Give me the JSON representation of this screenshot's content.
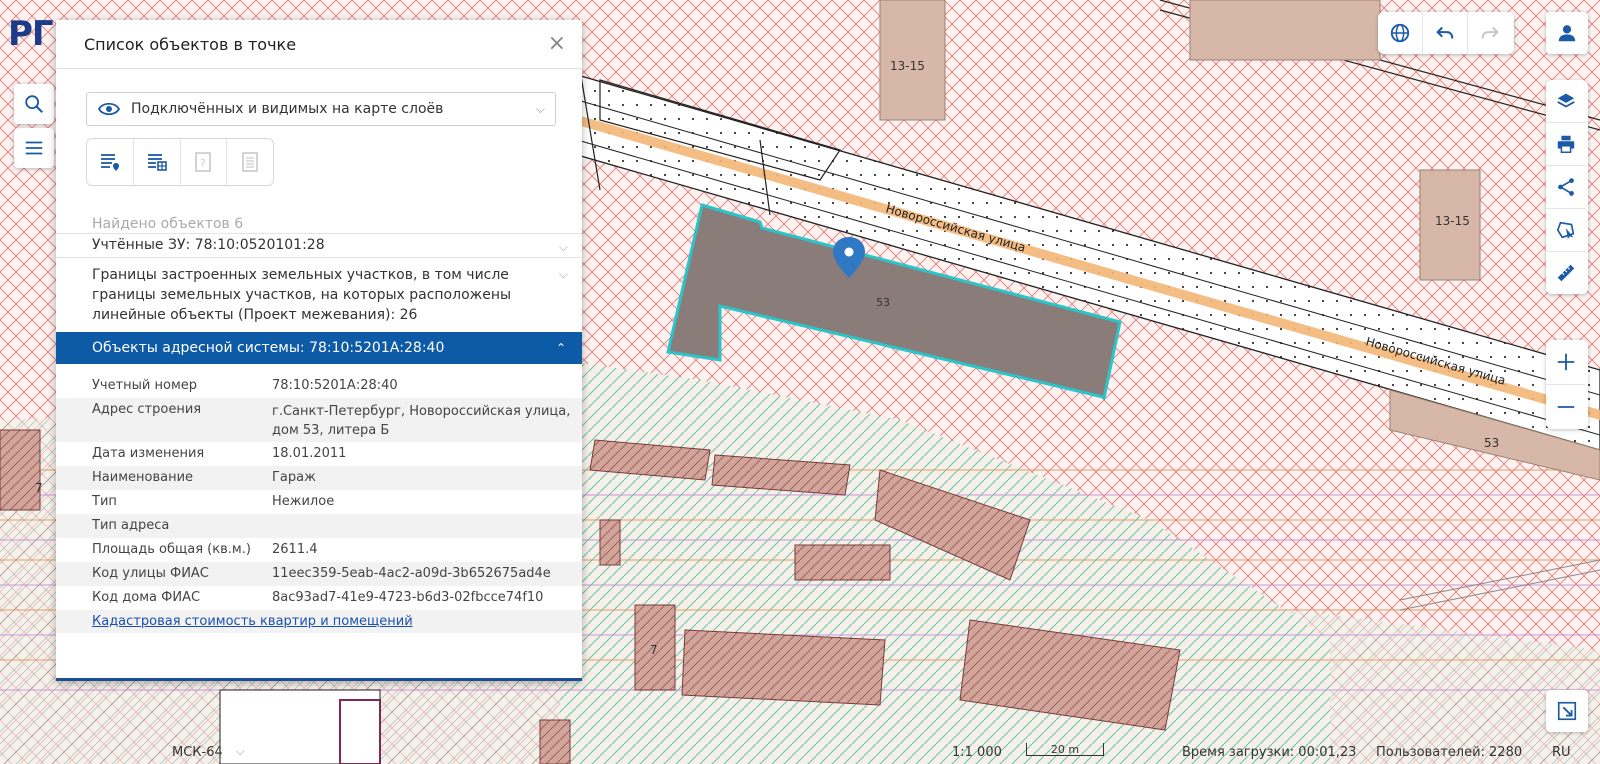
{
  "brand": {
    "logo_text": "РГ"
  },
  "panel": {
    "title": "Список объектов в точке",
    "close_glyph": "×",
    "layer_select_value": "Подключённых и видимых на карте слоёв",
    "found_text": "Найдено объектов 6",
    "accordion": [
      {
        "label": "Учтённые ЗУ: 78:10:0520101:28"
      },
      {
        "label": "Границы застроенных земельных участков, в том числе границы земельных участков, на которых расположены линейные объекты (Проект межевания): 26"
      }
    ],
    "active_section": "Объекты адресной системы: 78:10:5201А:28:40",
    "properties": [
      {
        "key": "Учетный номер",
        "value": "78:10:5201А:28:40"
      },
      {
        "key": "Адрес строения",
        "value": "г.Санкт-Петербург, Новороссийская улица, дом 53, литера Б"
      },
      {
        "key": "Дата изменения",
        "value": "18.01.2011"
      },
      {
        "key": "Наименование",
        "value": "Гараж"
      },
      {
        "key": "Тип",
        "value": "Нежилое"
      },
      {
        "key": "Тип адреса",
        "value": ""
      },
      {
        "key": "Площадь общая (кв.м.)",
        "value": "2611.4"
      },
      {
        "key": "Код улицы ФИАС",
        "value": "11eec359-5eab-4ac2-a09d-3b652675ad4e"
      },
      {
        "key": "Код дома ФИАС",
        "value": "8ac93ad7-41e9-4723-b6d3-02fbcce74f10"
      }
    ],
    "link_text": "Кадастровая стоимость квартир и помещений"
  },
  "map": {
    "street_label_1": "Новороссийская улица",
    "street_label_2": "Новороссийская улица",
    "labels": {
      "b1": "13-15",
      "b2": "13-15",
      "b3": "53",
      "b4": "53",
      "b5": "7",
      "b6": "7"
    }
  },
  "statusbar": {
    "crs": "МСК-64",
    "scale": "1:1 000",
    "scale_bar": "20 m",
    "load_time": "Время загрузки: 00:01,23",
    "users": "Пользователей: 2280",
    "lang": "RU"
  },
  "colors": {
    "accent": "#0d5aa7",
    "parcel_fill": "#8a7c78",
    "highlight": "#2bc4c9",
    "hatch_red": "#e07a7a"
  }
}
